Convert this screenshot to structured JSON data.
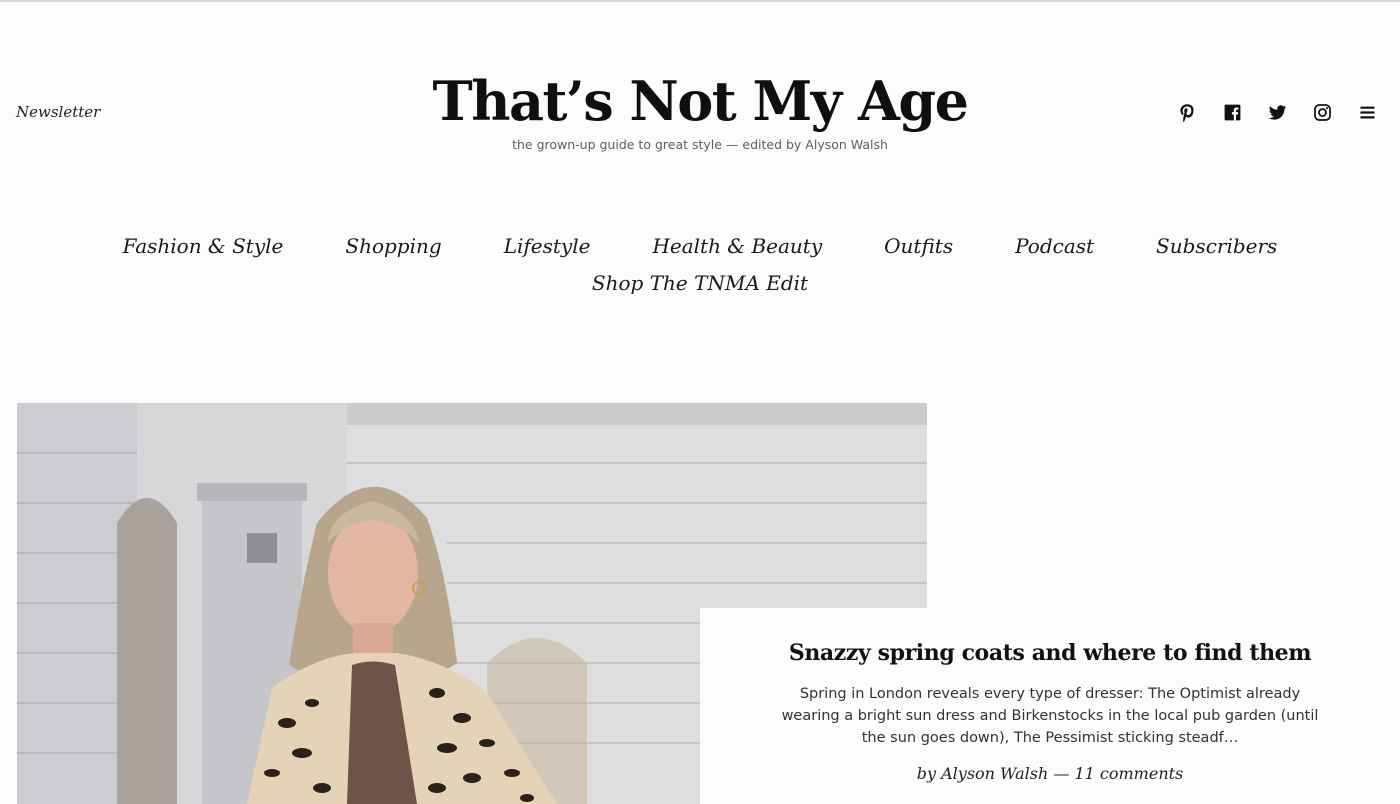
{
  "header": {
    "newsletter_label": "Newsletter",
    "site_title": "That’s Not My Age",
    "tagline": "the grown-up guide to great style — edited by Alyson Walsh",
    "social_icons": [
      "pinterest-icon",
      "facebook-icon",
      "twitter-icon",
      "instagram-icon",
      "menu-icon"
    ]
  },
  "nav": {
    "items": [
      "Fashion & Style",
      "Shopping",
      "Lifestyle",
      "Health & Beauty",
      "Outfits",
      "Podcast",
      "Subscribers",
      "Shop The TNMA Edit"
    ]
  },
  "featured": {
    "title": "Snazzy spring coats and where to find them",
    "excerpt": "Spring in London reveals every type of dresser: The Optimist already wearing a bright sun dress and Birkenstocks in the local pub garden (until the sun goes down), The Pessimist sticking steadf…",
    "author": "by Alyson Walsh",
    "separator": "—",
    "comments": "11 comments"
  },
  "colors": {
    "background": "#fcfcfd",
    "text": "#111111",
    "tagline": "#5f5f5f"
  }
}
